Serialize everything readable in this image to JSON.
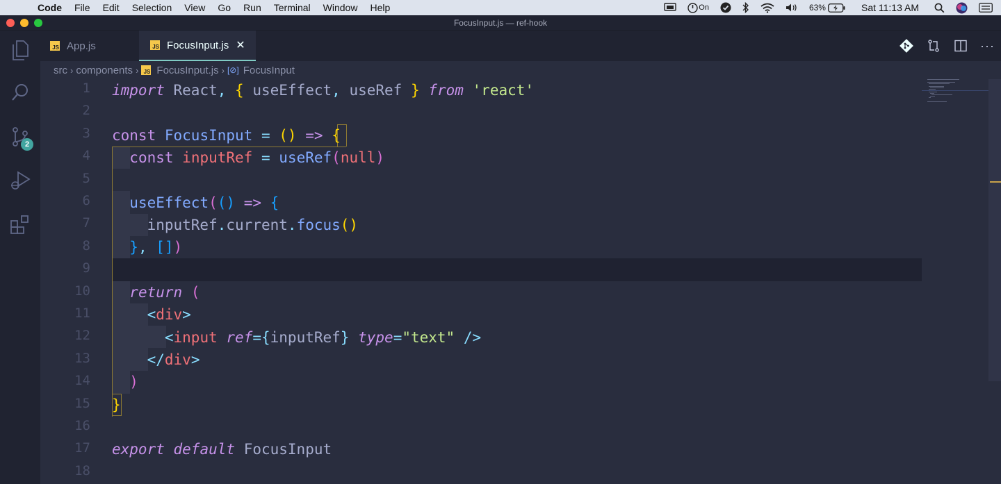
{
  "menubar": {
    "app": "Code",
    "items": [
      "File",
      "Edit",
      "Selection",
      "View",
      "Go",
      "Run",
      "Terminal",
      "Window",
      "Help"
    ],
    "focus_status": "On",
    "battery": "63%",
    "clock": "Sat 11:13 AM"
  },
  "window": {
    "title": "FocusInput.js — ref-hook"
  },
  "activitybar": {
    "scm_badge": "2"
  },
  "tabs": [
    {
      "label": "App.js",
      "icon": "js",
      "active": false
    },
    {
      "label": "FocusInput.js",
      "icon": "js",
      "active": true
    }
  ],
  "breadcrumb": [
    "src",
    "components",
    "FocusInput.js",
    "FocusInput"
  ],
  "editor": {
    "line_numbers": [
      "1",
      "2",
      "3",
      "4",
      "5",
      "6",
      "7",
      "8",
      "9",
      "10",
      "11",
      "12",
      "13",
      "14",
      "15",
      "16",
      "17",
      "18"
    ],
    "current_line": "9"
  },
  "colors": {
    "background": "#292d3e",
    "keyword": "#c792ea",
    "function": "#82aaff",
    "variable": "#f07178",
    "string": "#c3e88d",
    "accent": "#80cbc4"
  }
}
